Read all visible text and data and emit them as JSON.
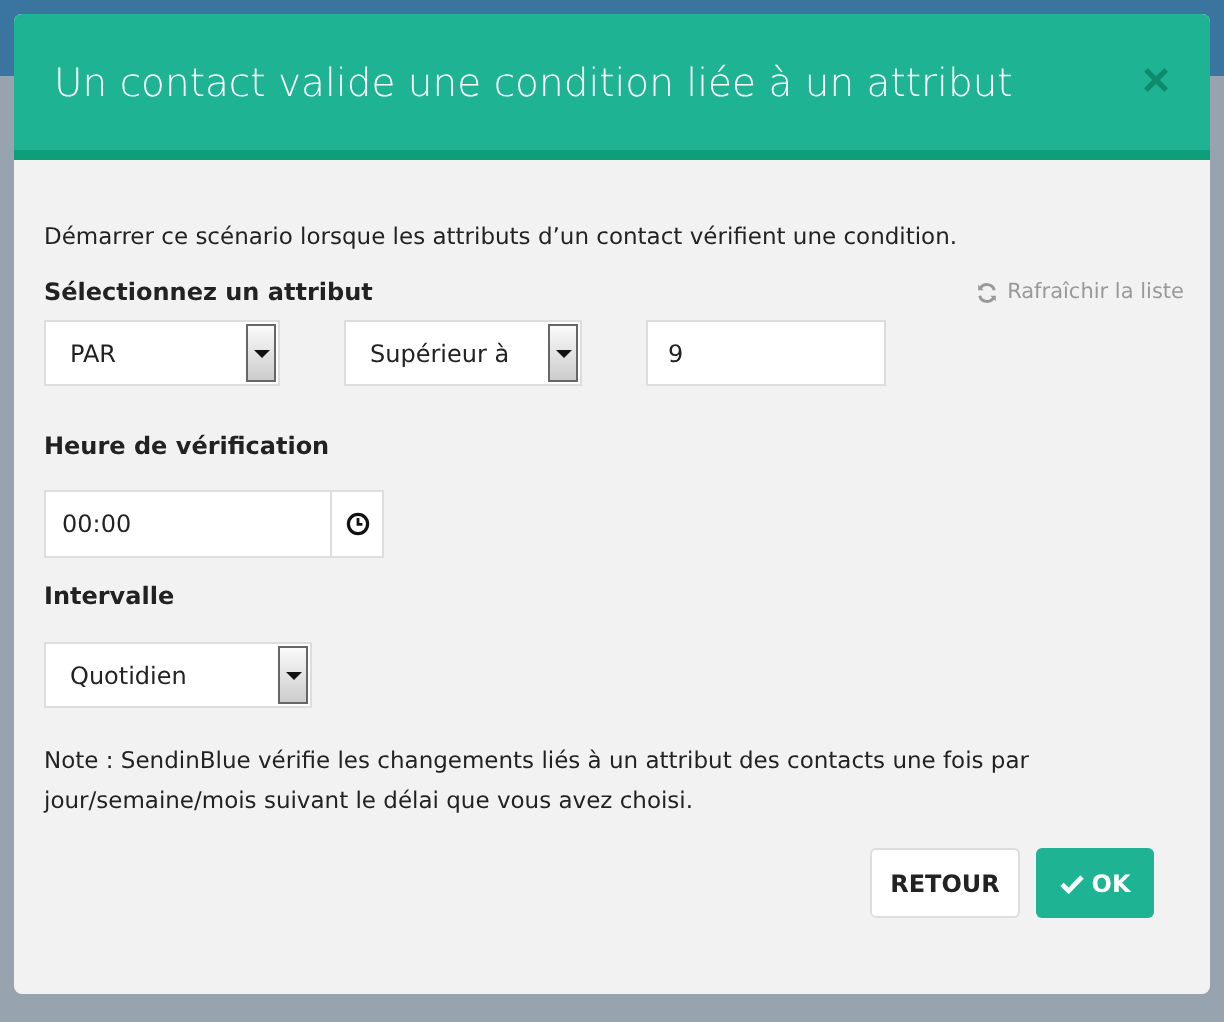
{
  "dialog": {
    "title": "Un contact valide une condition liée à un attribut",
    "close": "×",
    "description": "Démarrer ce scénario lorsque les attributs d’un contact vérifient une condition.",
    "attribute_section": {
      "label": "Sélectionnez un attribut",
      "refresh_link": "Rafraîchir la liste",
      "attribute_select": "PAR",
      "operator_select": "Supérieur à",
      "value": "9"
    },
    "time_section": {
      "label": "Heure de vérification",
      "value": "00:00"
    },
    "interval_section": {
      "label": "Intervalle",
      "select": "Quotidien"
    },
    "note": "Note : SendinBlue vérifie les changements liés à un attribut des contacts une fois par jour/semaine/mois suivant le délai que vous avez choisi.",
    "buttons": [
      {
        "label": "RETOUR",
        "kind": "secondary"
      },
      {
        "label": "OK",
        "kind": "primary"
      }
    ]
  }
}
